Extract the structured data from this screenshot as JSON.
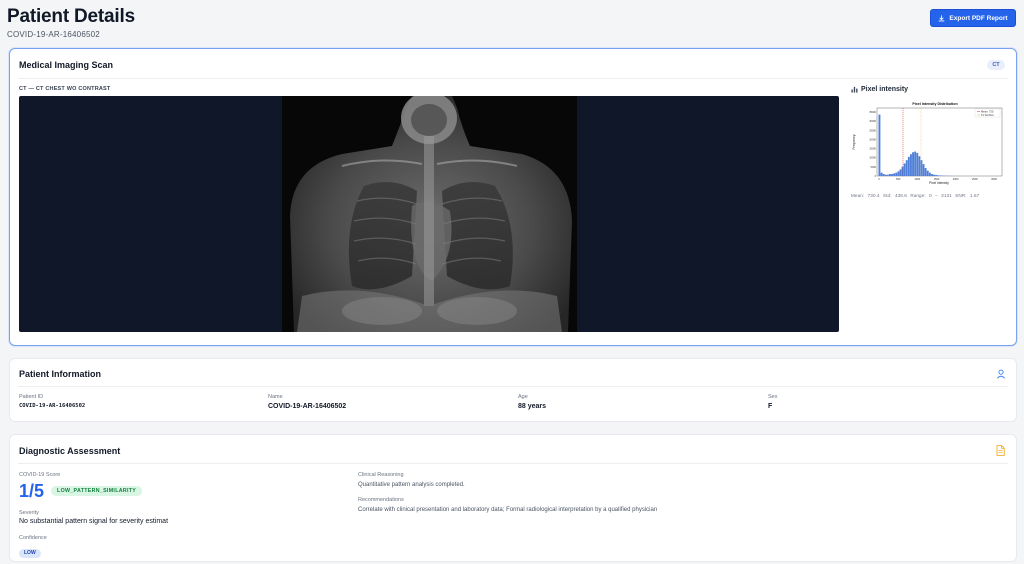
{
  "page": {
    "title": "Patient Details",
    "subtitle": "COVID-19-AR-16406502",
    "export_label": "Export PDF Report"
  },
  "imaging": {
    "title": "Medical Imaging Scan",
    "badge": "CT",
    "scan_label": "CT — CT CHEST WO CONTRAST",
    "pixel_title": "Pixel intensity",
    "stats": "Mean: 730.4   Std: 438.6   Range: 0 – 3131   SNR: 1.67",
    "histogram": {
      "title": "Pixel Intensity Distribution",
      "xlabel": "Pixel Intensity",
      "ylabel": "Frequency",
      "legend": [
        "Mean: 730",
        "±1 Std Dev"
      ],
      "x_ticks": [
        "0",
        "500",
        "1000",
        "1500",
        "2000",
        "2500",
        "3000"
      ],
      "y_ticks": [
        "0",
        "5000",
        "10000",
        "15000",
        "20000",
        "25000",
        "30000",
        "35000"
      ],
      "accent_bars": "#4f7fd9",
      "mean_line": "#d62728",
      "std_line": "#e6b422"
    }
  },
  "patient": {
    "title": "Patient Information",
    "fields": [
      {
        "label": "Patient ID",
        "value": "COVID-19-AR-16406502"
      },
      {
        "label": "Name",
        "value": "COVID-19-AR-16406502"
      },
      {
        "label": "Age",
        "value": "88 years"
      },
      {
        "label": "Sex",
        "value": "F"
      }
    ]
  },
  "diagnostic": {
    "title": "Diagnostic Assessment",
    "score_label": "COVID-19 Score",
    "score_value": "1/5",
    "score_badge": "LOW_PATTERN_SIMILARITY",
    "severity_label": "Severity",
    "severity_value": "No substantial pattern signal for severity estimat",
    "confidence_label": "Confidence",
    "confidence_value": "LOW",
    "reasoning_label": "Clinical Reasoning",
    "reasoning_value": "Quantitative pattern analysis completed.",
    "recommendations_label": "Recommendations",
    "recommendations_value": "Correlate with clinical presentation and laboratory data; Formal radiological interpretation by a qualified physician"
  },
  "colors": {
    "accent": "#2563eb",
    "badge_green_bg": "#d9f5e3",
    "badge_green_text": "#15803d",
    "viewport_bg": "#101729"
  }
}
